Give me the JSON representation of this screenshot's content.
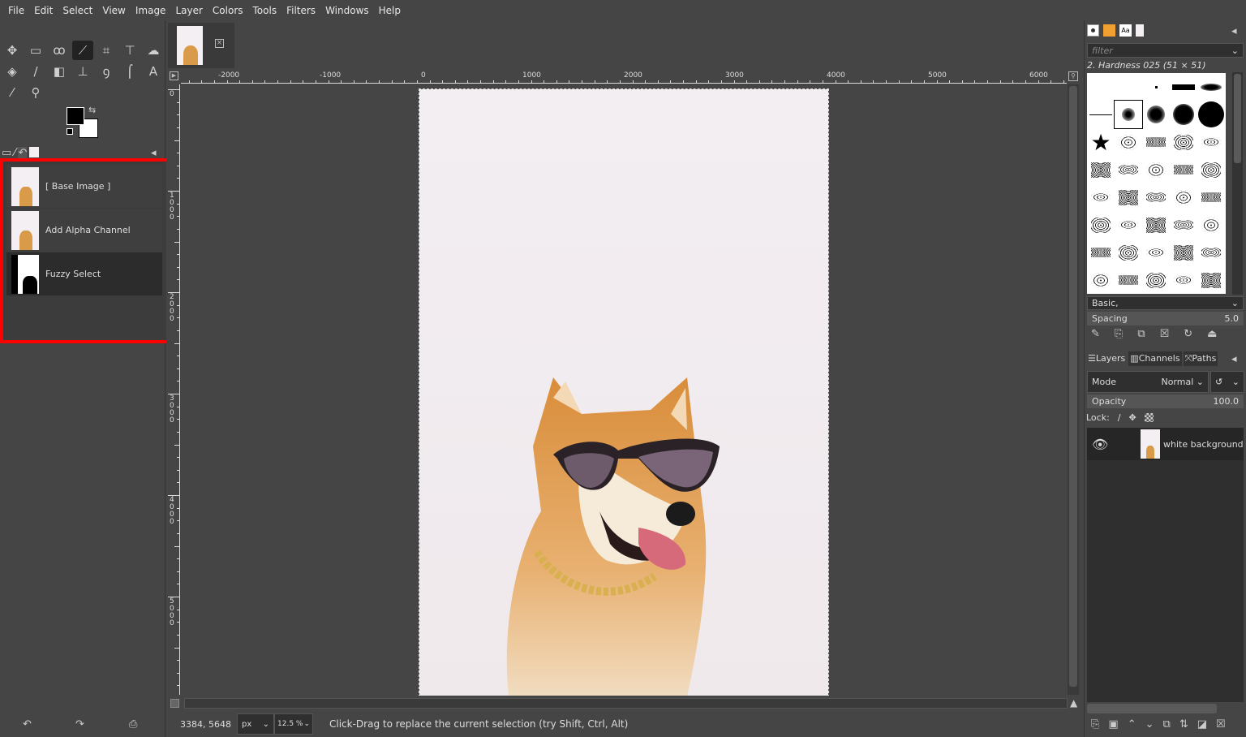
{
  "menu": [
    "File",
    "Edit",
    "Select",
    "View",
    "Image",
    "Layer",
    "Colors",
    "Tools",
    "Filters",
    "Windows",
    "Help"
  ],
  "tools": [
    {
      "icon": "move-icon",
      "glyph": "✥"
    },
    {
      "icon": "rect-select-icon",
      "glyph": "▭"
    },
    {
      "icon": "lasso-icon",
      "glyph": "ꝏ"
    },
    {
      "icon": "fuzzy-select-icon",
      "glyph": "⟋",
      "active": true
    },
    {
      "icon": "crop-icon",
      "glyph": "⌗"
    },
    {
      "icon": "transform-icon",
      "glyph": "⊤"
    },
    {
      "icon": "warp-icon",
      "glyph": "☁"
    },
    {
      "icon": "bucket-fill-icon",
      "glyph": "◈"
    },
    {
      "icon": "paintbrush-icon",
      "glyph": "∕"
    },
    {
      "icon": "eraser-icon",
      "glyph": "◧"
    },
    {
      "icon": "clone-icon",
      "glyph": "⊥"
    },
    {
      "icon": "smudge-icon",
      "glyph": "ꝯ"
    },
    {
      "icon": "paths-icon",
      "glyph": "⌠"
    },
    {
      "icon": "text-icon",
      "glyph": "A"
    },
    {
      "icon": "color-picker-icon",
      "glyph": "⁄"
    },
    {
      "icon": "zoom-icon",
      "glyph": "⚲"
    }
  ],
  "colors": {
    "foreground": "#000000",
    "background": "#ffffff",
    "highlight": "#ff0000"
  },
  "history": {
    "items": [
      {
        "label": "[ Base Image ]",
        "thumb": "dog"
      },
      {
        "label": "Add Alpha Channel",
        "thumb": "dog"
      },
      {
        "label": "Fuzzy Select",
        "thumb": "mask",
        "selected": true
      }
    ]
  },
  "rulers": {
    "h": [
      "-2000",
      "-1000",
      "0",
      "1000",
      "2000",
      "3000",
      "4000",
      "5000",
      "6000"
    ],
    "v": [
      "0",
      "1000",
      "2000",
      "3000",
      "4000",
      "5000"
    ]
  },
  "status": {
    "coords": "3384, 5648",
    "unit": "px",
    "zoom": "12.5 %",
    "message": "Click-Drag to replace the current selection (try Shift, Ctrl, Alt)"
  },
  "brushes": {
    "filter_placeholder": "filter",
    "selected": "2. Hardness 025 (51 × 51)",
    "tag": "Basic,",
    "spacing_label": "Spacing",
    "spacing_value": "5.0"
  },
  "layers_panel": {
    "tabs": [
      "Layers",
      "Channels",
      "Paths"
    ],
    "mode_label": "Mode",
    "mode_value": "Normal",
    "opacity_label": "Opacity",
    "opacity_value": "100.0",
    "lock_label": "Lock:",
    "layers": [
      {
        "name": "white background",
        "visible": true
      }
    ]
  }
}
